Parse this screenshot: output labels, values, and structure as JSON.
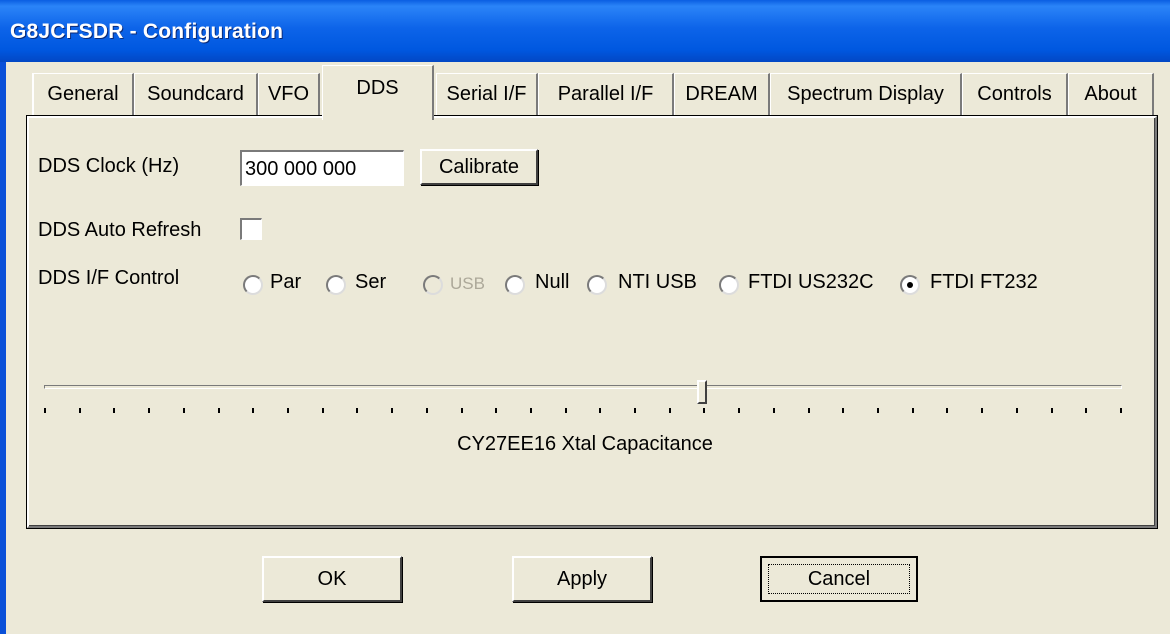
{
  "window": {
    "title": "G8JCFSDR - Configuration"
  },
  "tabs": [
    {
      "label": "General",
      "active": false
    },
    {
      "label": "Soundcard",
      "active": false
    },
    {
      "label": "VFO",
      "active": false
    },
    {
      "label": "DDS",
      "active": true
    },
    {
      "label": "Serial I/F",
      "active": false
    },
    {
      "label": "Parallel I/F",
      "active": false
    },
    {
      "label": "DREAM",
      "active": false
    },
    {
      "label": "Spectrum Display",
      "active": false
    },
    {
      "label": "Controls",
      "active": false
    },
    {
      "label": "About",
      "active": false
    }
  ],
  "dds": {
    "clock_label": "DDS Clock (Hz)",
    "clock_value": "300 000 000",
    "calibrate_label": "Calibrate",
    "auto_refresh_label": "DDS Auto Refresh",
    "auto_refresh_checked": false,
    "if_control_label": "DDS I/F Control",
    "if_options": [
      {
        "label": "Par",
        "selected": false,
        "enabled": true
      },
      {
        "label": "Ser",
        "selected": false,
        "enabled": true
      },
      {
        "label": "USB",
        "selected": false,
        "enabled": false
      },
      {
        "label": "Null",
        "selected": false,
        "enabled": true
      },
      {
        "label": "NTI USB",
        "selected": false,
        "enabled": true
      },
      {
        "label": "FTDI US232C",
        "selected": false,
        "enabled": true
      },
      {
        "label": "FTDI FT232",
        "selected": true,
        "enabled": true
      }
    ],
    "slider_label": "CY27EE16 Xtal Capacitance",
    "slider_position_fraction": 0.61,
    "slider_tick_count": 32
  },
  "buttons": {
    "ok": "OK",
    "apply": "Apply",
    "cancel": "Cancel"
  }
}
